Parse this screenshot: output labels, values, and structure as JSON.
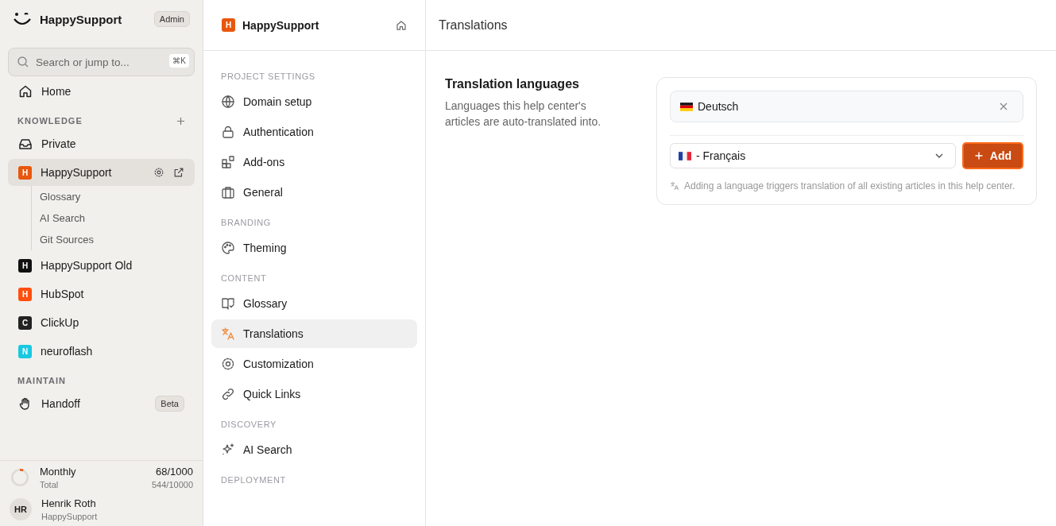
{
  "sidebar": {
    "brand": "HappySupport",
    "role_badge": "Admin",
    "search": {
      "placeholder": "Search or jump to...",
      "shortcut": "⌘K"
    },
    "home": "Home",
    "knowledge": {
      "title": "KNOWLEDGE",
      "items": [
        {
          "kind": "inbox",
          "label": "Private",
          "selected": false
        },
        {
          "kind": "project",
          "letter": "H",
          "color": "#e8570e",
          "label": "HappySupport",
          "selected": true,
          "children": [
            {
              "label": "Glossary"
            },
            {
              "label": "AI Search"
            },
            {
              "label": "Git Sources"
            }
          ]
        },
        {
          "kind": "project",
          "letter": "H",
          "color": "#111111",
          "label": "HappySupport Old",
          "selected": false
        },
        {
          "kind": "project",
          "letter": "H",
          "color": "#ff4f0f",
          "label": "HubSpot",
          "selected": false
        },
        {
          "kind": "project",
          "letter": "C",
          "color": "#222222",
          "label": "ClickUp",
          "selected": false
        },
        {
          "kind": "project",
          "letter": "N",
          "color": "#1ac8e0",
          "label": "neuroflash",
          "selected": false
        }
      ]
    },
    "maintain": {
      "title": "MAINTAIN",
      "items": [
        {
          "label": "Handoff",
          "badge": "Beta"
        }
      ]
    },
    "usage": {
      "label": "Monthly",
      "value": "68/1000",
      "sublabel": "Total",
      "subvalue": "544/10000",
      "level": 0.068
    },
    "user": {
      "initials": "HR",
      "name": "Henrik Roth",
      "org": "HappySupport"
    }
  },
  "settings_nav": {
    "project": {
      "letter": "H",
      "name": "HappySupport"
    },
    "sections": [
      {
        "title": "PROJECT SETTINGS",
        "items": [
          {
            "label": "Domain setup",
            "selected": false
          },
          {
            "label": "Authentication",
            "selected": false
          },
          {
            "label": "Add-ons",
            "selected": false
          },
          {
            "label": "General",
            "selected": false
          }
        ]
      },
      {
        "title": "BRANDING",
        "items": [
          {
            "label": "Theming",
            "selected": false
          }
        ]
      },
      {
        "title": "CONTENT",
        "items": [
          {
            "label": "Glossary",
            "selected": false
          },
          {
            "label": "Translations",
            "selected": true
          },
          {
            "label": "Customization",
            "selected": false
          },
          {
            "label": "Quick Links",
            "selected": false
          }
        ]
      },
      {
        "title": "DISCOVERY",
        "items": [
          {
            "label": "AI Search",
            "selected": false
          }
        ]
      },
      {
        "title": "DEPLOYMENT"
      }
    ]
  },
  "page": {
    "title": "Translations",
    "section_title": "Translation languages",
    "section_description": "Languages this help center's articles are auto-translated into.",
    "languages": [
      {
        "label": "Deutsch"
      }
    ],
    "select": {
      "value": "- Français"
    },
    "add_button": "Add",
    "hint": "Adding a language triggers translation of all existing articles in this help center."
  }
}
